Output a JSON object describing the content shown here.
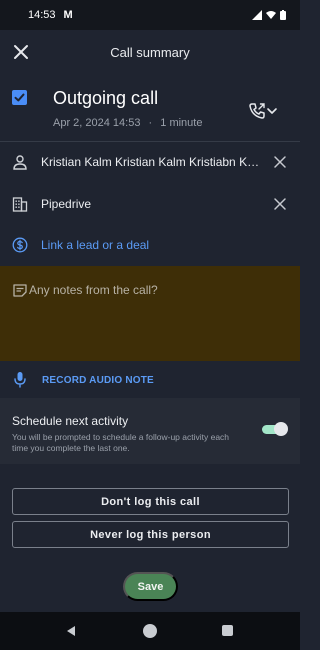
{
  "status_bar": {
    "time": "14:53",
    "app_badge": "M"
  },
  "header": {
    "title": "Call summary"
  },
  "call": {
    "checked": true,
    "title": "Outgoing call",
    "date": "Apr 2, 2024 14:53",
    "separator": "·",
    "duration": "1 minute"
  },
  "fields": {
    "person": "Kristian Kalm Kristian Kalm Kristiabn Kalm",
    "organization": "Pipedrive",
    "deal_link": "Link a lead or a deal"
  },
  "notes": {
    "placeholder": "Any notes from the call?"
  },
  "record": {
    "label": "RECORD AUDIO NOTE"
  },
  "schedule": {
    "title": "Schedule next activity",
    "description": "You will be prompted to schedule a follow-up activity each time you complete the last one.",
    "enabled": true
  },
  "actions": {
    "dont_log": "Don't log this call",
    "never_log": "Never log this person",
    "save": "Save"
  },
  "colors": {
    "background": "#1f2430",
    "accent_blue": "#5b9bf5",
    "notes_bg": "#3e2e07",
    "save_green": "#4a8456"
  }
}
